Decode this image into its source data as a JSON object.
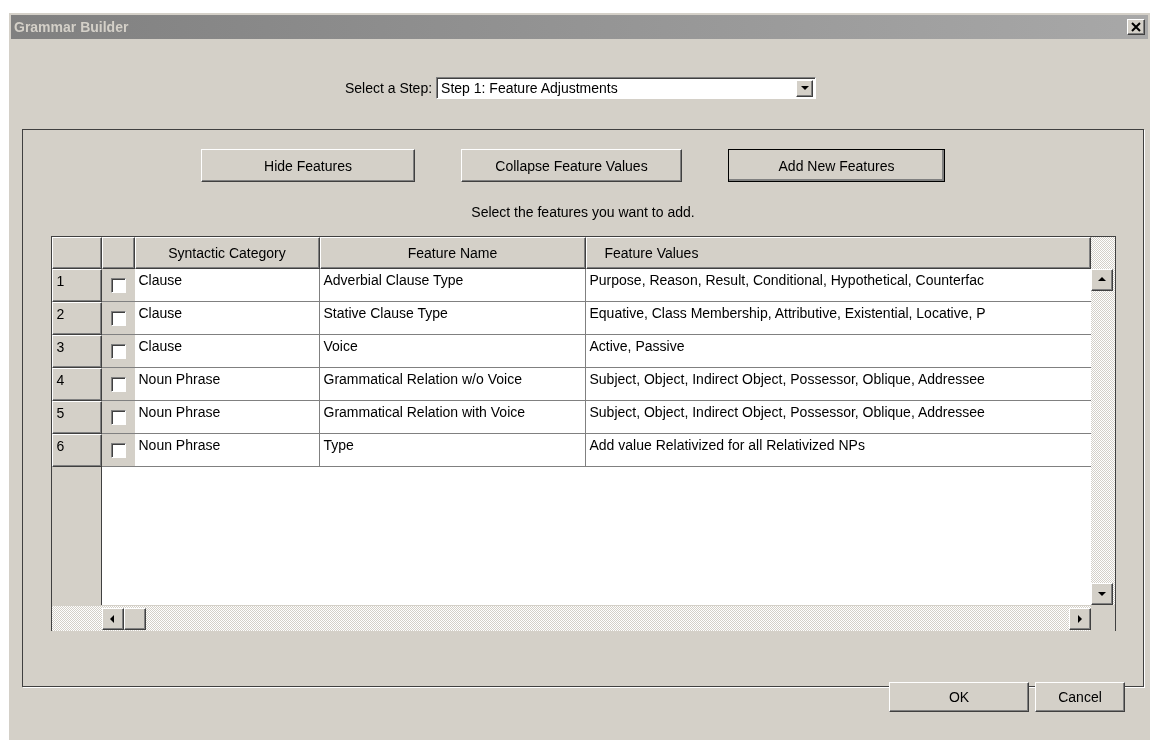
{
  "window": {
    "title": "Grammar Builder"
  },
  "step_select": {
    "label": "Select a Step:",
    "value": "Step 1: Feature Adjustments"
  },
  "toolbar_buttons": [
    {
      "label": "Hide Features",
      "selected": false
    },
    {
      "label": "Collapse Feature Values",
      "selected": false
    },
    {
      "label": "Add New Features",
      "selected": true
    }
  ],
  "instruction": "Select the features you want to add.",
  "table": {
    "columns": [
      "Syntactic Category",
      "Feature Name",
      "Feature Values"
    ],
    "rows": [
      {
        "number": "1",
        "checked": false,
        "cells": [
          "Clause",
          "Adverbial Clause Type",
          "Purpose, Reason, Result, Conditional, Hypothetical, Counterfac"
        ]
      },
      {
        "number": "2",
        "checked": false,
        "cells": [
          "Clause",
          "Stative Clause Type",
          "Equative, Class Membership, Attributive, Existential, Locative, P"
        ]
      },
      {
        "number": "3",
        "checked": false,
        "cells": [
          "Clause",
          "Voice",
          "Active, Passive"
        ]
      },
      {
        "number": "4",
        "checked": false,
        "cells": [
          "Noun Phrase",
          "Grammatical Relation w/o Voice",
          "Subject, Object, Indirect Object, Possessor, Oblique, Addressee"
        ]
      },
      {
        "number": "5",
        "checked": false,
        "cells": [
          "Noun Phrase",
          "Grammatical Relation with Voice",
          "Subject, Object, Indirect Object, Possessor, Oblique, Addressee"
        ]
      },
      {
        "number": "6",
        "checked": false,
        "cells": [
          "Noun Phrase",
          "Type",
          "Add value Relativized for all Relativized NPs"
        ]
      }
    ]
  },
  "buttons": [
    "OK",
    "Cancel"
  ]
}
